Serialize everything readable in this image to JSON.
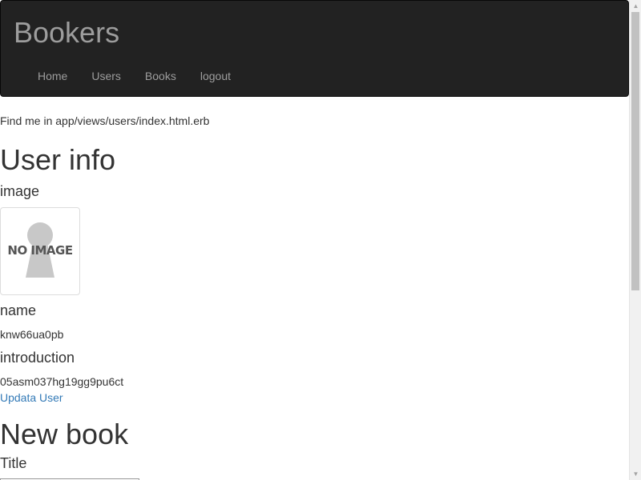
{
  "navbar": {
    "brand": "Bookers",
    "links": [
      "Home",
      "Users",
      "Books",
      "logout"
    ]
  },
  "hint": "Find me in app/views/users/index.html.erb",
  "user_info": {
    "heading": "User info",
    "image_label": "image",
    "placeholder_text": "NO IMAGE",
    "name_label": "name",
    "name_value": "knw66ua0pb",
    "intro_label": "introduction",
    "intro_value": "05asm037hg19gg9pu6ct",
    "update_link": "Updata User"
  },
  "new_book": {
    "heading": "New book",
    "title_label": "Title"
  },
  "colors": {
    "navbar_bg": "#222222",
    "nav_text": "#9d9d9d",
    "link": "#337ab7"
  },
  "icons": {
    "placeholder": "keyhole-person-silhouette-icon",
    "scroll_up": "arrow-up-icon",
    "scroll_down": "arrow-down-icon"
  }
}
